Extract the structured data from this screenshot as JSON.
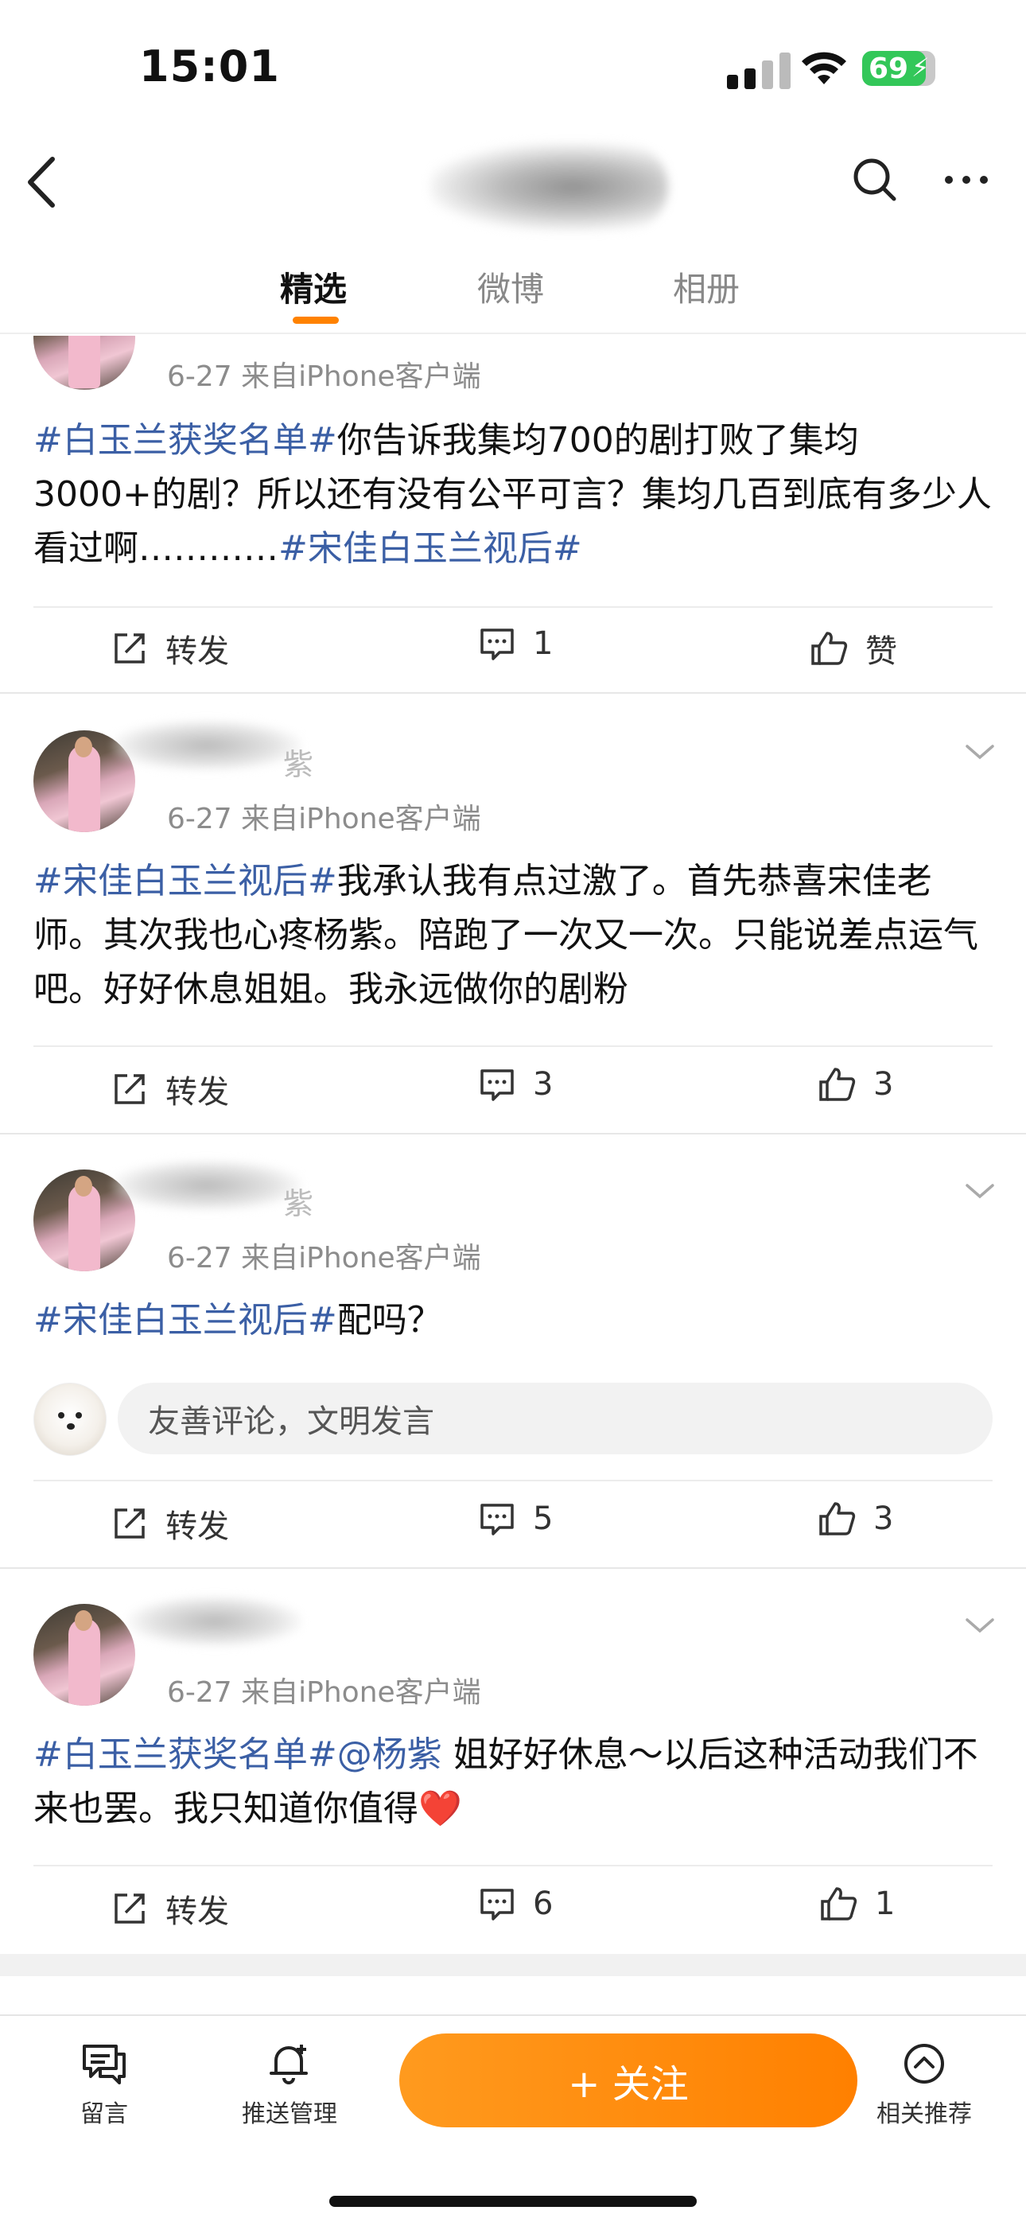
{
  "status_bar": {
    "time": "15:01",
    "battery": "69"
  },
  "tabs": [
    "精选",
    "微博",
    "相册"
  ],
  "posts": [
    {
      "meta": "6-27  来自iPhone客户端",
      "text_parts": [
        {
          "t": "#白玉兰获奖名单#",
          "topic": true
        },
        {
          "t": "你告诉我集均700的剧打败了集均3000+的剧？所以还有没有公平可言？集均几百到底有多少人看过啊…………",
          "topic": false
        },
        {
          "t": "#宋佳白玉兰视后#",
          "topic": true
        }
      ],
      "repost": "转发",
      "comments": "1",
      "likes": "赞"
    },
    {
      "name_partial": "紫",
      "meta": "6-27  来自iPhone客户端",
      "text_parts": [
        {
          "t": "#宋佳白玉兰视后#",
          "topic": true
        },
        {
          "t": "我承认我有点过激了。首先恭喜宋佳老师。其次我也心疼杨紫。陪跑了一次又一次。只能说差点运气吧。好好休息姐姐。我永远做你的剧粉",
          "topic": false
        }
      ],
      "repost": "转发",
      "comments": "3",
      "likes": "3"
    },
    {
      "name_partial": "紫",
      "meta": "6-27  来自iPhone客户端",
      "text_parts": [
        {
          "t": "#宋佳白玉兰视后#",
          "topic": true
        },
        {
          "t": "配吗？",
          "topic": false
        }
      ],
      "comment_placeholder": "友善评论，文明发言",
      "repost": "转发",
      "comments": "5",
      "likes": "3"
    },
    {
      "meta": "6-27  来自iPhone客户端",
      "text_parts": [
        {
          "t": "#白玉兰获奖名单#@杨紫",
          "topic": true
        },
        {
          "t": " 姐好好休息～以后这种活动我们不来也罢。我只知道你值得❤️",
          "topic": false
        }
      ],
      "repost": "转发",
      "comments": "6",
      "likes": "1"
    }
  ],
  "bottom_bar": {
    "message": "留言",
    "push": "推送管理",
    "follow": "+ 关注",
    "related": "相关推荐"
  },
  "colors": {
    "accent": "#ff8200",
    "topic": "#3b5fa5"
  },
  "icons": [
    "back-icon",
    "search-icon",
    "more-icon",
    "repost-icon",
    "comment-icon",
    "like-icon",
    "chevron-down-icon",
    "message-icon",
    "bell-icon",
    "related-icon"
  ]
}
